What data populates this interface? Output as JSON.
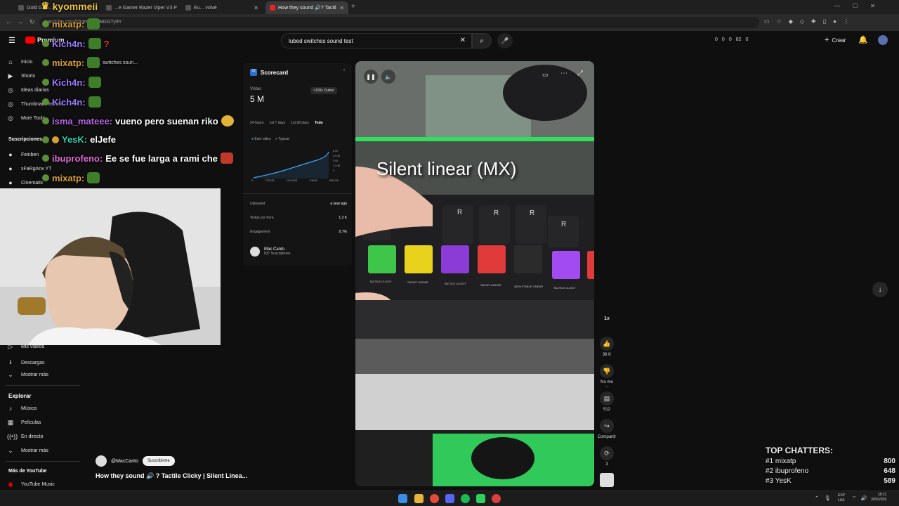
{
  "tabs": [
    {
      "label": "Gold Gam...",
      "active": false
    },
    {
      "label": "...e Gamer Razer Viper V3 P",
      "active": false
    },
    {
      "label": "Eu... volvé",
      "active": false
    },
    {
      "label": "How they sound 🔊? Tactil",
      "active": true
    }
  ],
  "address": {
    "url": "youtube.com/shorts/uAoNGGTy9Y"
  },
  "youtube": {
    "logo": "Premium",
    "search_value": "lubed switches sound test",
    "create_label": "Crear",
    "counters": [
      "0",
      "0",
      "0",
      "82",
      "0"
    ]
  },
  "sidebar": {
    "items": [
      {
        "label": "Inicio",
        "icon": "home-icon"
      },
      {
        "label": "Shorts",
        "icon": "shorts-icon"
      },
      {
        "label": "Ideas diarias",
        "icon": "idea-icon"
      },
      {
        "label": "Thumbnail Preview",
        "icon": "image-icon"
      },
      {
        "label": "More Tools",
        "icon": "tools-icon"
      }
    ],
    "subs_header": "Suscripciones",
    "subs": [
      "Feinben",
      "xFaRgAnx YT",
      "Cinematix"
    ],
    "lower_items": [
      {
        "label": "Mis videos"
      },
      {
        "label": "Descargas"
      },
      {
        "label": "Mostrar más"
      }
    ],
    "explore_header": "Explorar",
    "explore_items": [
      {
        "label": "Música"
      },
      {
        "label": "Películas"
      },
      {
        "label": "En directo"
      },
      {
        "label": "Mostrar más"
      }
    ],
    "more_header": "Más de YouTube",
    "more_items": [
      {
        "label": "YouTube Music"
      }
    ]
  },
  "chat": [
    {
      "user": "kyommeii",
      "text": "",
      "color": "#f2c744"
    },
    {
      "user": "mixatp:",
      "text": "",
      "color": "#d9a037"
    },
    {
      "user": "Kich4n:",
      "text": "?",
      "color": "#9d7bff"
    },
    {
      "user": "mixatp:",
      "text": "switches soun...",
      "color": "#d9a037"
    },
    {
      "user": "Kich4n:",
      "text": "",
      "color": "#9d7bff"
    },
    {
      "user": "Kich4n:",
      "text": "",
      "color": "#9d7bff"
    },
    {
      "user": "isma_mateee:",
      "text": "vueno pero suenan riko",
      "color": "#b565e0"
    },
    {
      "user": "YesK:",
      "text": "elJefe",
      "color": "#2fd0b0"
    },
    {
      "user": "ibuprofeno:",
      "text": "Ee se fue larga a rami che",
      "color": "#e06cd6"
    },
    {
      "user": "mixatp:",
      "text": "",
      "color": "#d9a037"
    }
  ],
  "scorecard": {
    "title": "Scorecard",
    "views_label": "Vistas",
    "views_value": "5 M",
    "outlier": ">100x Outlier",
    "ranges": [
      "24 hours",
      "1st 7 days",
      "1st 28 days",
      "Todo"
    ],
    "legend": [
      "Este video",
      "Typical"
    ],
    "y_ticks": [
      "6 M",
      "4.5 M",
      "3 M",
      "1.5 M",
      "0"
    ],
    "x_ticks": [
      "0",
      "7/22/25",
      "10/14/25",
      "1/6/26",
      "3/31/26"
    ],
    "rows": [
      {
        "label": "Uploaded",
        "value": "a year ago"
      },
      {
        "label": "Vistas por hora",
        "value": "1.3 K"
      },
      {
        "label": "Engagement",
        "value": "0.7%"
      }
    ],
    "channel_name": "Mac Canto",
    "channel_subs": "837 Suscriptores"
  },
  "video": {
    "overlay_text": "Silent linear (MX)",
    "switch_labels": [
      "TACTILE CLICKY",
      "SILENT LINEAR",
      "TACTILE CLICKY",
      "SILENT LINEAR",
      "ADJUSTABLE LINEAR",
      "TACTILE CLICKY"
    ],
    "keycap_letter": "R"
  },
  "rail": {
    "speed": "1x",
    "likes": "36 K",
    "dislike_label": "No me ...",
    "comments": "512",
    "share_label": "Compartir",
    "remix": "3"
  },
  "channel": {
    "handle": "@MacCanto",
    "subscribe_label": "Suscribirme",
    "video_title": "How they sound 🔊 ? Tactile Clicky | Silent Linea..."
  },
  "top_chatters": {
    "title": "TOP CHATTERS:",
    "rows": [
      {
        "rank": "#1 mixatp",
        "count": "800"
      },
      {
        "rank": "#2 ibuprofeno",
        "count": "648"
      },
      {
        "rank": "#3 YesK",
        "count": "589"
      }
    ]
  },
  "taskbar": {
    "lang": "ESP\nLAA",
    "time": "18:21",
    "date": "30/5/2026"
  },
  "colors": {
    "bg": "#0f0f0f",
    "accent_red": "#ff0000",
    "chart_line": "#3ea6ff"
  }
}
